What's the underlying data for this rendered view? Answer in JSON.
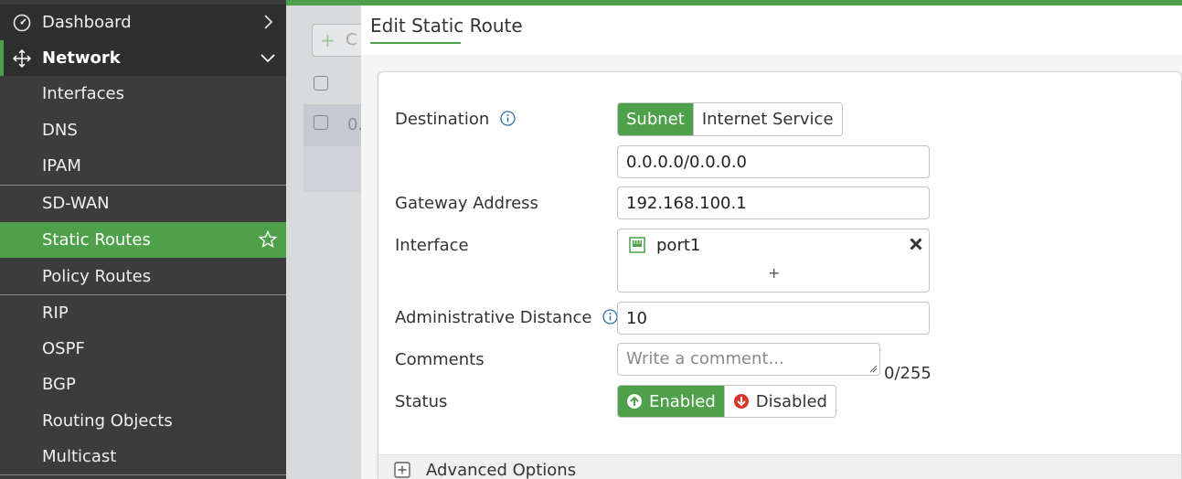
{
  "sidebar": {
    "dashboard": "Dashboard",
    "network": "Network",
    "items": [
      {
        "label": "Interfaces"
      },
      {
        "label": "DNS"
      },
      {
        "label": "IPAM"
      },
      {
        "label": "SD-WAN"
      },
      {
        "label": "Static Routes"
      },
      {
        "label": "Policy Routes"
      },
      {
        "label": "RIP"
      },
      {
        "label": "OSPF"
      },
      {
        "label": "BGP"
      },
      {
        "label": "Routing Objects"
      },
      {
        "label": "Multicast"
      }
    ],
    "active_item": "Static Routes"
  },
  "background": {
    "create_prefix": "C",
    "row_value_prefix": "0."
  },
  "dialog": {
    "title": "Edit Static Route",
    "fields": {
      "destination_label": "Destination",
      "destination_options": [
        "Subnet",
        "Internet Service"
      ],
      "destination_selected": "Subnet",
      "destination_value": "0.0.0.0/0.0.0.0",
      "gateway_label": "Gateway Address",
      "gateway_value": "192.168.100.1",
      "interface_label": "Interface",
      "interface_value": "port1",
      "interface_add": "+",
      "distance_label": "Administrative Distance",
      "distance_value": "10",
      "comments_label": "Comments",
      "comments_placeholder": "Write a comment...",
      "comments_counter": "0/255",
      "status_label": "Status",
      "status_enabled": "Enabled",
      "status_disabled": "Disabled",
      "status_selected": "Enabled"
    },
    "advanced_label": "Advanced Options"
  },
  "icons": {
    "dashboard": "dashboard-gauge-icon",
    "network": "network-move-icon",
    "favorite": "star-icon",
    "info": "info-icon",
    "port": "port-icon",
    "remove": "close-x-icon",
    "enabled": "arrow-up-circle-icon",
    "disabled": "arrow-down-circle-icon",
    "expand": "plus-square-icon"
  },
  "colors": {
    "accent_green": "#4fa04a",
    "sidebar_bg": "#3c3c3c",
    "disabled_red": "#d9342b",
    "info_blue": "#2f6fa8"
  }
}
